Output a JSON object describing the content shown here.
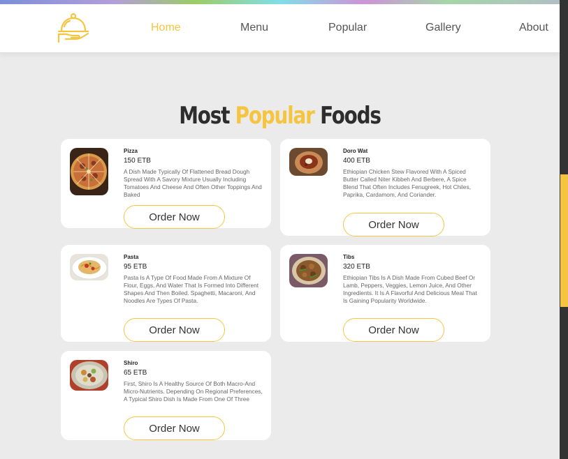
{
  "nav": {
    "items": [
      {
        "label": "Home",
        "active": true
      },
      {
        "label": "Menu",
        "active": false
      },
      {
        "label": "Popular",
        "active": false
      },
      {
        "label": "Gallery",
        "active": false
      },
      {
        "label": "About",
        "active": false
      }
    ],
    "logo_icon": "serving-cloche-icon"
  },
  "section": {
    "title_part1": "Most",
    "title_accent": "Popular",
    "title_part2": "Foods"
  },
  "colors": {
    "accent": "#f5c542",
    "page_bg": "#ebebeb",
    "card_bg": "#ffffff",
    "title_dark": "#2d2d2d"
  },
  "foods": [
    {
      "name": "Pizza",
      "price": "150 ETB",
      "description": "A Dish Made Typically Of Flattened Bread Dough Spread With A Savory Mixture Usually Including Tomatoes And Cheese And Often Other Toppings And Baked",
      "button": "Order Now",
      "image_icon": "pizza-photo"
    },
    {
      "name": "Doro Wat",
      "price": "400 ETB",
      "description": "Ethiopian Chicken Stew Flavored With A Spiced Butter Called Niter Kibbeh And Berbere, A Spice Blend That Often Includes Fenugreek, Hot Chiles, Paprika, Cardamom, And Coriander.",
      "button": "Order Now",
      "image_icon": "doro-wat-photo"
    },
    {
      "name": "Pasta",
      "price": "95 ETB",
      "description": "Pasta Is A Type Of Food Made From A Mixture Of Flour, Eggs, And Water That Is Formed Into Different Shapes And Then Boiled. Spaghetti, Macaroni, And Noodles Are Types Of Pasta.",
      "button": "Order Now",
      "image_icon": "pasta-photo"
    },
    {
      "name": "Tibs",
      "price": "320 ETB",
      "description": "Ethiopian Tibs Is A Dish Made From Cubed Beef Or Lamb, Peppers, Veggies, Lemon Juice, And Other Ingredients. It Is A Flavorful And Delicious Meal That Is Gaining Popularity Worldwide.",
      "button": "Order Now",
      "image_icon": "tibs-photo"
    },
    {
      "name": "Shiro",
      "price": "65 ETB",
      "description": "First, Shiro Is A Healthy Source Of Both Macro-And Micro-Nutrients. Depending On Regional Preferences, A Typical Shiro Dish Is Made From One Of Three",
      "button": "Order Now",
      "image_icon": "shiro-photo"
    }
  ]
}
